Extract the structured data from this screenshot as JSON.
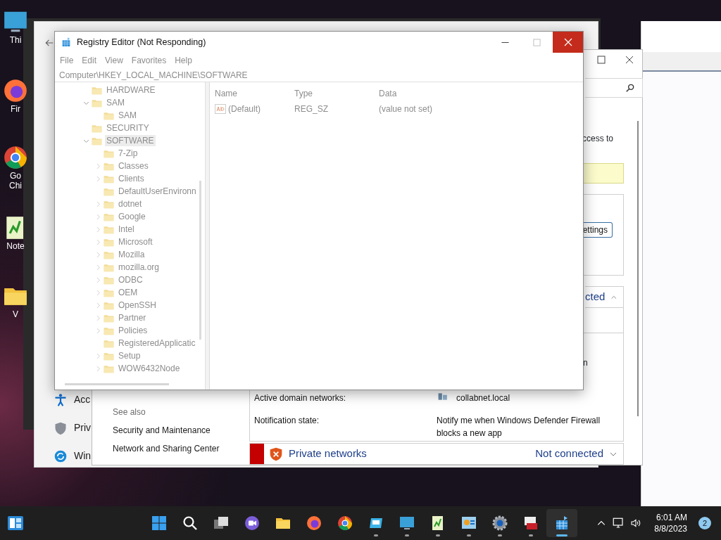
{
  "desktop_icons": [
    {
      "kind": "monitor",
      "label": "Thi"
    },
    {
      "kind": "firefox",
      "label": "Fir"
    },
    {
      "kind": "chrome",
      "label": "Go Chi"
    },
    {
      "kind": "notepad",
      "label": "Note"
    },
    {
      "kind": "folder",
      "label": "V"
    }
  ],
  "settings_window": {
    "nav_items": [
      {
        "kind": "accessibility",
        "label": "Acc"
      },
      {
        "kind": "shield",
        "label": "Priv"
      },
      {
        "kind": "update",
        "label": "Win"
      }
    ]
  },
  "firewall_window": {
    "intro_tail": "ccess to",
    "settings_button": "ettings",
    "domain_header": {
      "status": "cted",
      "expanded": true
    },
    "detail_tail": "n",
    "details": [
      {
        "kind": "network",
        "label": "Active domain networks:",
        "value": "collabnet.local"
      },
      {
        "kind": "text",
        "label": "Notification state:",
        "value": "Notify me when Windows Defender Firewall blocks a new app"
      }
    ],
    "see_also": {
      "heading": "See also",
      "links": [
        "Security and Maintenance",
        "Network and Sharing Center"
      ]
    },
    "private_networks": {
      "label": "Private networks",
      "status": "Not connected",
      "expanded": false
    }
  },
  "registry_editor": {
    "title": "Registry Editor (Not Responding)",
    "menu": [
      "File",
      "Edit",
      "View",
      "Favorites",
      "Help"
    ],
    "address": "Computer\\HKEY_LOCAL_MACHINE\\SOFTWARE",
    "tree": [
      {
        "label": "HARDWARE",
        "expandable": false,
        "expanded": false,
        "selected": false
      },
      {
        "label": "SAM",
        "expandable": true,
        "expanded": true,
        "selected": false,
        "children": [
          {
            "label": "SAM",
            "expandable": false,
            "expanded": false,
            "selected": false
          }
        ]
      },
      {
        "label": "SECURITY",
        "expandable": false,
        "expanded": false,
        "selected": false
      },
      {
        "label": "SOFTWARE",
        "expandable": true,
        "expanded": true,
        "selected": true,
        "children": [
          {
            "label": "7-Zip",
            "expandable": false,
            "expanded": false,
            "selected": false
          },
          {
            "label": "Classes",
            "expandable": true,
            "expanded": false,
            "selected": false
          },
          {
            "label": "Clients",
            "expandable": true,
            "expanded": false,
            "selected": false
          },
          {
            "label": "DefaultUserEnvironn",
            "expandable": false,
            "expanded": false,
            "selected": false
          },
          {
            "label": "dotnet",
            "expandable": true,
            "expanded": false,
            "selected": false
          },
          {
            "label": "Google",
            "expandable": true,
            "expanded": false,
            "selected": false
          },
          {
            "label": "Intel",
            "expandable": true,
            "expanded": false,
            "selected": false
          },
          {
            "label": "Microsoft",
            "expandable": true,
            "expanded": false,
            "selected": false
          },
          {
            "label": "Mozilla",
            "expandable": true,
            "expanded": false,
            "selected": false
          },
          {
            "label": "mozilla.org",
            "expandable": true,
            "expanded": false,
            "selected": false
          },
          {
            "label": "ODBC",
            "expandable": true,
            "expanded": false,
            "selected": false
          },
          {
            "label": "OEM",
            "expandable": true,
            "expanded": false,
            "selected": false
          },
          {
            "label": "OpenSSH",
            "expandable": true,
            "expanded": false,
            "selected": false
          },
          {
            "label": "Partner",
            "expandable": true,
            "expanded": false,
            "selected": false
          },
          {
            "label": "Policies",
            "expandable": true,
            "expanded": false,
            "selected": false
          },
          {
            "label": "RegisteredApplicatic",
            "expandable": false,
            "expanded": false,
            "selected": false
          },
          {
            "label": "Setup",
            "expandable": true,
            "expanded": false,
            "selected": false
          },
          {
            "label": "WOW6432Node",
            "expandable": true,
            "expanded": false,
            "selected": false
          }
        ]
      }
    ],
    "columns": [
      "Name",
      "Type",
      "Data"
    ],
    "values": [
      {
        "name": "(Default)",
        "type": "REG_SZ",
        "data": "(value not set)"
      }
    ]
  },
  "taskbar": {
    "apps": [
      {
        "kind": "start",
        "running": false,
        "active": false
      },
      {
        "kind": "search",
        "running": false,
        "active": false
      },
      {
        "kind": "taskview",
        "running": false,
        "active": false
      },
      {
        "kind": "chat",
        "running": false,
        "active": false
      },
      {
        "kind": "folder",
        "running": false,
        "active": false
      },
      {
        "kind": "firefox",
        "running": false,
        "active": false
      },
      {
        "kind": "chrome",
        "running": false,
        "active": false
      },
      {
        "kind": "remote",
        "running": true,
        "active": false
      },
      {
        "kind": "monitor",
        "running": true,
        "active": false
      },
      {
        "kind": "notepad",
        "running": true,
        "active": false
      },
      {
        "kind": "panel",
        "running": true,
        "active": false
      },
      {
        "kind": "gear",
        "running": true,
        "active": false
      },
      {
        "kind": "toolbox",
        "running": true,
        "active": false
      },
      {
        "kind": "registry",
        "running": true,
        "active": true
      }
    ],
    "time": "6:01 AM",
    "date": "8/8/2023",
    "notifications": "2"
  }
}
